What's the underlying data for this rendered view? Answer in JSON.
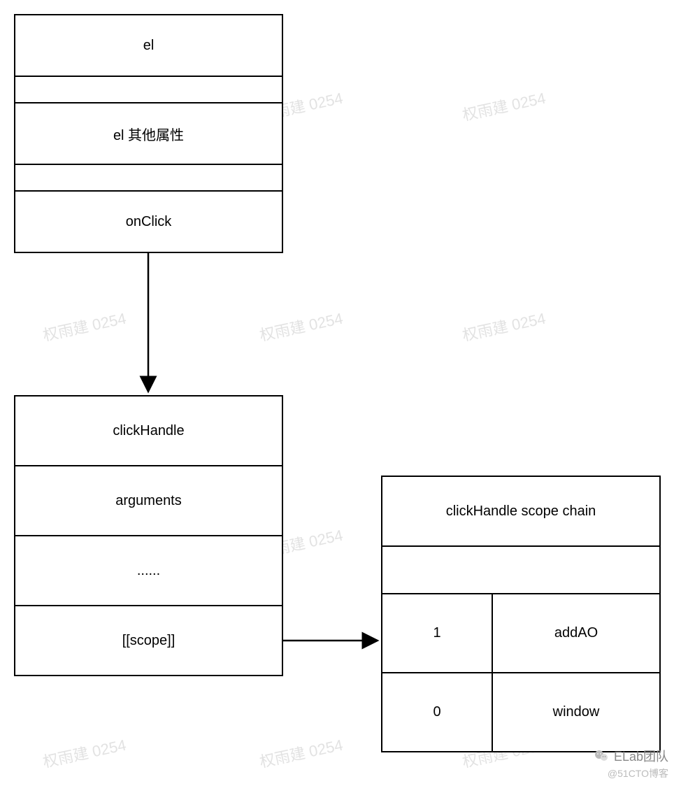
{
  "watermark": {
    "text": "权雨建 0254"
  },
  "boxes": {
    "el": {
      "rows": [
        "el",
        "",
        "el 其他属性",
        "",
        "onClick"
      ]
    },
    "clickHandle": {
      "rows": [
        "clickHandle",
        "arguments",
        "......",
        "[[scope]]"
      ]
    },
    "scopeChain": {
      "title": "clickHandle scope chain",
      "rows": [
        {
          "index": "1",
          "value": "addAO"
        },
        {
          "index": "0",
          "value": "window"
        }
      ]
    }
  },
  "footer": {
    "brand": "ELab团队",
    "sub": "@51CTO博客"
  }
}
